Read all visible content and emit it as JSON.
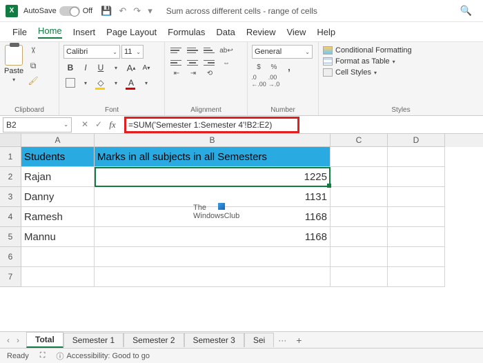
{
  "title": {
    "autosave_label": "AutoSave",
    "autosave_state": "Off",
    "document_title": "Sum across different cells - range of cells"
  },
  "tabs": {
    "file": "File",
    "home": "Home",
    "insert": "Insert",
    "page_layout": "Page Layout",
    "formulas": "Formulas",
    "data": "Data",
    "review": "Review",
    "view": "View",
    "help": "Help"
  },
  "ribbon": {
    "clipboard": {
      "label": "Clipboard",
      "paste": "Paste"
    },
    "font": {
      "label": "Font",
      "name": "Calibri",
      "size": "11",
      "b": "B",
      "i": "I",
      "u": "U",
      "a_inc": "A",
      "a_dec": "A",
      "a_letter": "A"
    },
    "alignment": {
      "label": "Alignment",
      "wrap": "ab"
    },
    "number": {
      "label": "Number",
      "format": "General",
      "percent": "%",
      "comma": ",",
      "inc": ".0←",
      "dec": ".00→",
      "cur_ico": "$"
    },
    "styles": {
      "label": "Styles",
      "cond": "Conditional Formatting",
      "table": "Format as Table",
      "cell": "Cell Styles"
    }
  },
  "formulabar": {
    "namebox": "B2",
    "fx": "fx",
    "formula": "=SUM('Semester 1:Semester 4'!B2:E2)"
  },
  "columns": {
    "A": "A",
    "B": "B",
    "C": "C",
    "D": "D"
  },
  "rows": {
    "r1": "1",
    "r2": "2",
    "r3": "3",
    "r4": "4",
    "r5": "5",
    "r6": "6",
    "r7": "7"
  },
  "cells": {
    "A1": "Students",
    "B1": "Marks in all subjects in all Semesters",
    "A2": "Rajan",
    "B2": "1225",
    "A3": "Danny",
    "B3": "1131",
    "A4": "Ramesh",
    "B4": "1168",
    "A5": "Mannu",
    "B5": "1168"
  },
  "watermark": {
    "l1": "The",
    "l2": "WindowsClub"
  },
  "sheets": {
    "total": "Total",
    "s1": "Semester 1",
    "s2": "Semester 2",
    "s3": "Semester 3",
    "s4": "Sei",
    "more": "···",
    "add": "+"
  },
  "status": {
    "ready": "Ready",
    "acc": "Accessibility: Good to go"
  }
}
